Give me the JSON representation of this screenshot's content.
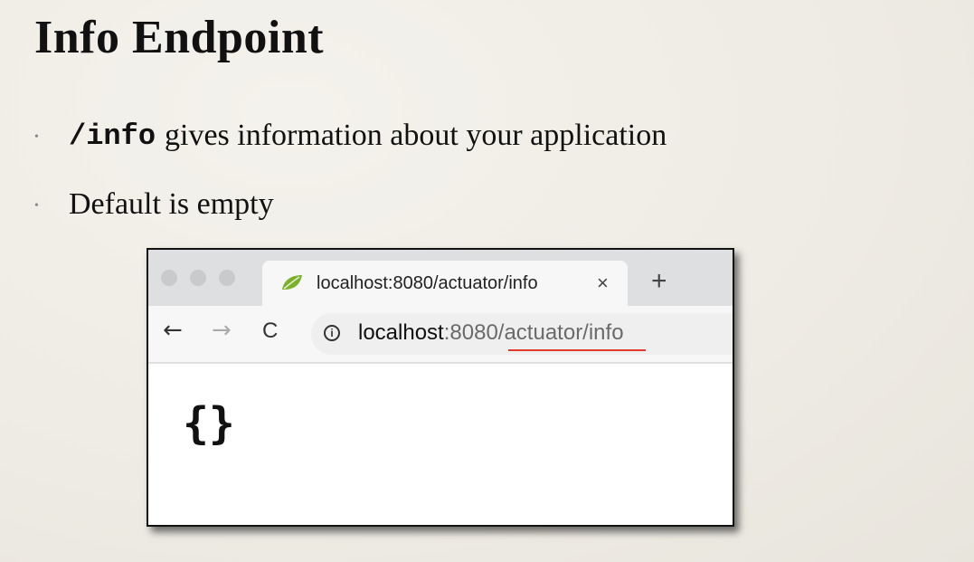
{
  "slide": {
    "title": "Info Endpoint",
    "bullets": [
      {
        "code": "/info",
        "text": "gives information about your application"
      },
      {
        "text": "Default is empty"
      }
    ]
  },
  "browser": {
    "tab": {
      "label": "localhost:8080/actuator/info",
      "close": "×"
    },
    "new_tab": "+",
    "nav": {
      "back": "←",
      "forward": "→",
      "reload": "C"
    },
    "url": {
      "host": "localhost",
      "rest": ":8080/actuator/info"
    },
    "page_content": "{}"
  },
  "colors": {
    "underline": "#e23a2a",
    "favicon": "#7ab02b"
  }
}
